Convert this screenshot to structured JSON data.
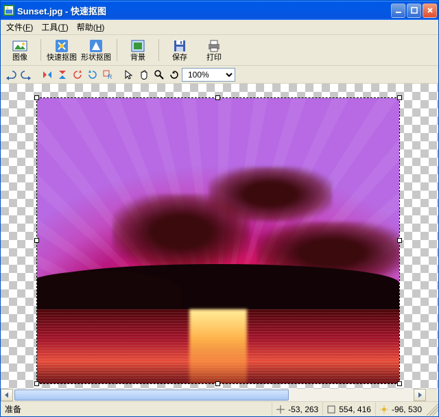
{
  "title": "Sunset.jpg - 快速抠图",
  "window_buttons": {
    "min": "_",
    "max": "□",
    "close": "×"
  },
  "menu": {
    "file": {
      "label": "文件",
      "key": "F"
    },
    "tools": {
      "label": "工具",
      "key": "T"
    },
    "help": {
      "label": "帮助",
      "key": "H"
    }
  },
  "toolbar1": {
    "image": "图像",
    "quick_cutout": "快速抠图",
    "shape_cutout": "形状抠图",
    "background": "背景",
    "save": "保存",
    "print": "打印"
  },
  "toolbar2": {
    "zoom_value": "100%"
  },
  "statusbar": {
    "ready": "准备",
    "pos": "-53, 263",
    "size": "554, 416",
    "brightness": "-96, 530"
  },
  "icons": {
    "app": "app-icon",
    "image": "image-icon",
    "quick": "quick-cutout-icon",
    "shape": "shape-cutout-icon",
    "background": "background-icon",
    "save": "save-icon",
    "print": "print-icon",
    "undo": "undo-icon",
    "redo": "redo-icon",
    "flip_h": "flip-h-icon",
    "flip_v": "flip-v-icon",
    "rotate_l": "rotate-left-icon",
    "rotate_r": "rotate-right-icon",
    "resize": "resize-icon",
    "pointer": "pointer-icon",
    "hand": "hand-icon",
    "magnifier": "magnifier-icon",
    "rotate": "rotate-tool-icon",
    "pos": "position-icon",
    "size": "size-icon",
    "brightness": "brightness-icon"
  }
}
